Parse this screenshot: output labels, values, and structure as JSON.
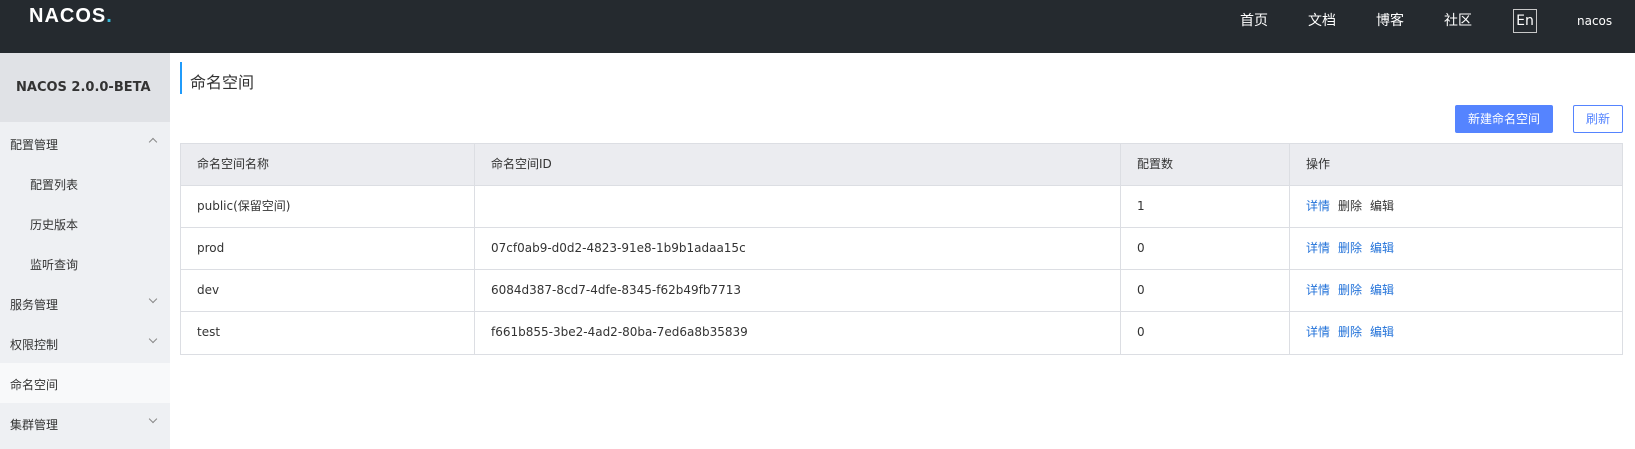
{
  "header": {
    "logo": "NACOS",
    "logo_dot": ".",
    "nav": [
      "首页",
      "文档",
      "博客",
      "社区"
    ],
    "lang": "En",
    "user": "nacos"
  },
  "sidebar": {
    "title": "NACOS 2.0.0-BETA",
    "items": [
      {
        "label": "配置管理",
        "expanded": true
      },
      {
        "label": "配置列表"
      },
      {
        "label": "历史版本"
      },
      {
        "label": "监听查询"
      },
      {
        "label": "服务管理"
      },
      {
        "label": "权限控制"
      },
      {
        "label": "命名空间",
        "active": true
      },
      {
        "label": "集群管理"
      }
    ]
  },
  "main": {
    "title": "命名空间",
    "create_button": "新建命名空间",
    "refresh_button": "刷新",
    "columns": [
      "命名空间名称",
      "命名空间ID",
      "配置数",
      "操作"
    ],
    "rows": [
      {
        "name": "public(保留空间)",
        "id": "",
        "count": "1",
        "actions": [
          "详情",
          "删除",
          "编辑"
        ]
      },
      {
        "name": "prod",
        "id": "07cf0ab9-d0d2-4823-91e8-1b9b1adaa15c",
        "count": "0",
        "actions": [
          "详情",
          "删除",
          "编辑"
        ]
      },
      {
        "name": "dev",
        "id": "6084d387-8cd7-4dfe-8345-f62b49fb7713",
        "count": "0",
        "actions": [
          "详情",
          "删除",
          "编辑"
        ]
      },
      {
        "name": "test",
        "id": "f661b855-3be2-4ad2-80ba-7ed6a8b35839",
        "count": "0",
        "actions": [
          "详情",
          "删除",
          "编辑"
        ]
      }
    ]
  },
  "colors": {
    "topbar": "#252a2f",
    "primary": "#5584ff",
    "link": "#2272d9",
    "accent": "#209bfa"
  }
}
